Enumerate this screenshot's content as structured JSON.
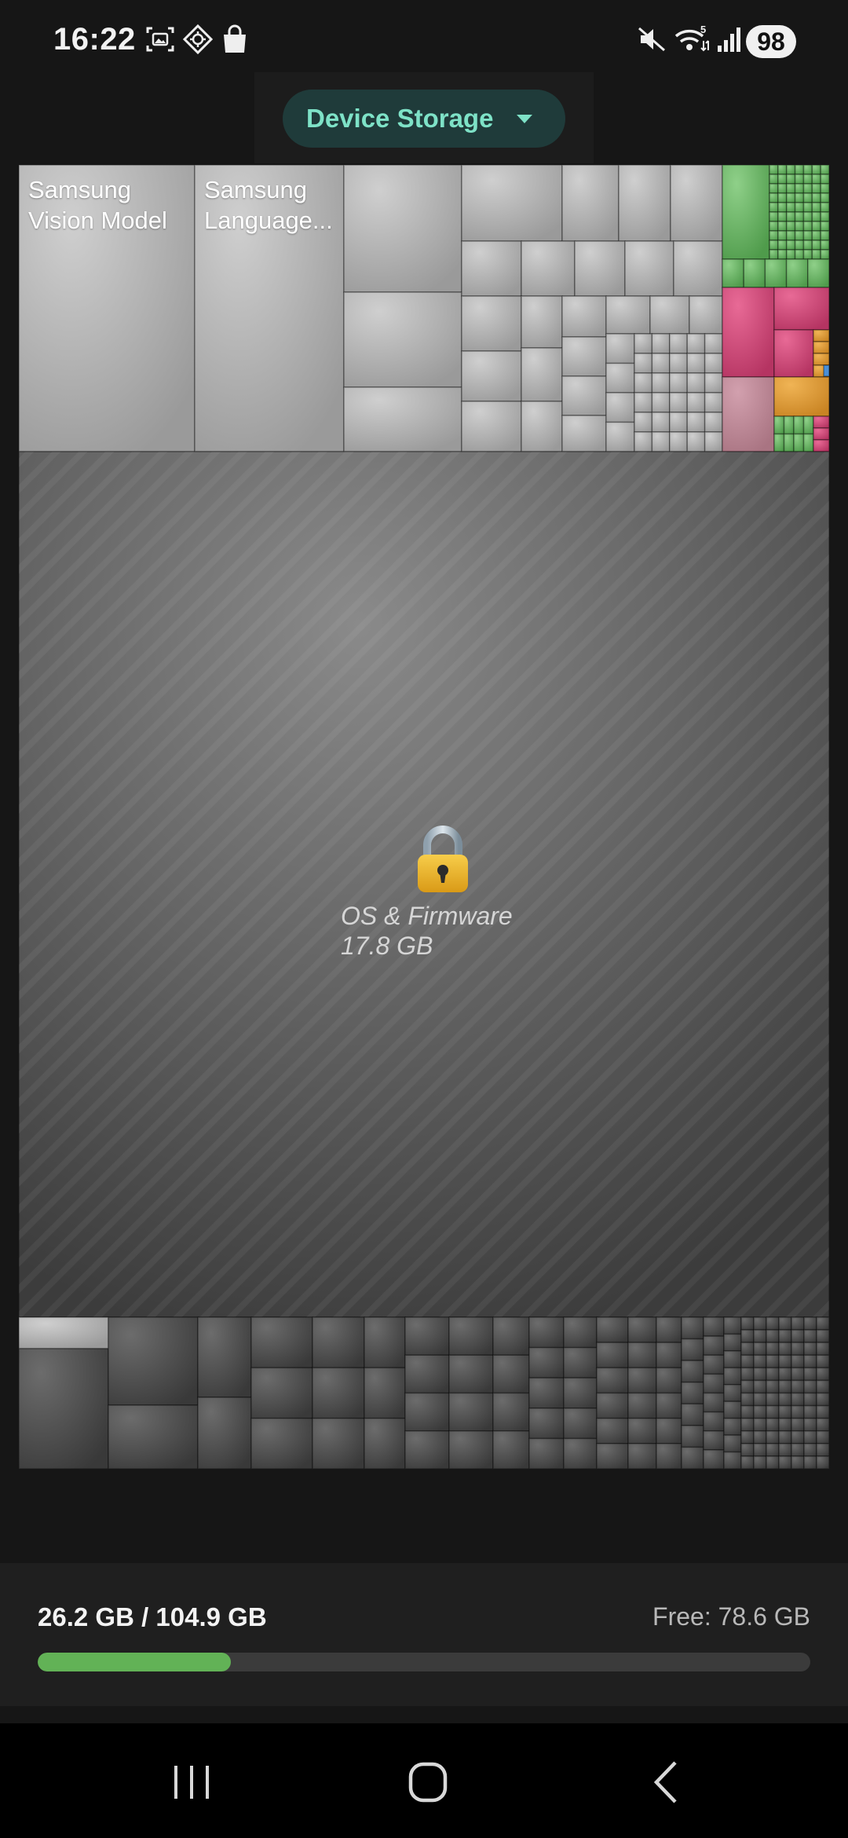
{
  "status_bar": {
    "time": "16:22",
    "left_icons": [
      "screenshot-icon",
      "app-diamond-icon",
      "shopping-bag-icon"
    ],
    "right_icons": [
      "mute-icon",
      "wifi-5-icon",
      "signal-icon"
    ],
    "battery": "98"
  },
  "header": {
    "dropdown_label": "Device Storage",
    "accent_color": "#7ee2c7"
  },
  "treemap": {
    "tiles": [
      {
        "label": "Samsung\nVision Model"
      },
      {
        "label": "Samsung\nLanguage..."
      }
    ],
    "os": {
      "icon": "lock-icon",
      "name": "OS & Firmware",
      "size": "17.8 GB"
    }
  },
  "footer": {
    "used": "26.2 GB / 104.9 GB",
    "free": "Free: 78.6 GB",
    "used_fraction": 0.25,
    "progress_color": "#62b256"
  },
  "nav": {
    "items": [
      "recents-icon",
      "home-icon",
      "back-icon"
    ]
  }
}
